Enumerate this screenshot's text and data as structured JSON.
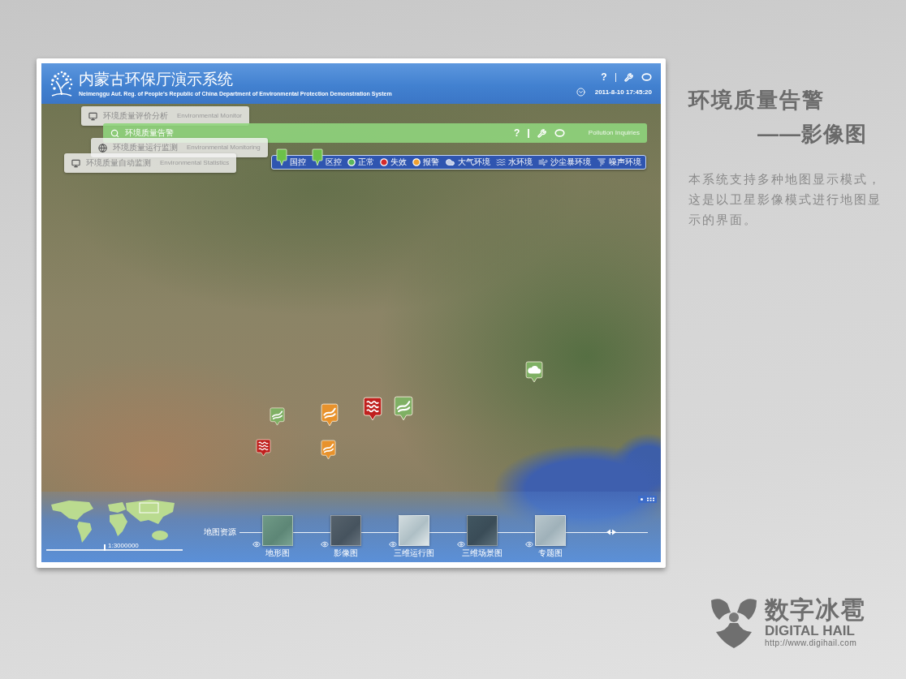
{
  "app_header": {
    "title": "内蒙古环保厅演示系统",
    "subtitle": "Neimenggu Aut. Reg. of People's Republic of China Department of Environmental Protection Demonstration System",
    "help": "?",
    "datetime": "2011-8-10 17:45:20"
  },
  "menus": [
    {
      "label": "环境质量评价分析",
      "english": "Environmental Monitor",
      "selected": false
    },
    {
      "label": "环境质量告警",
      "english": "Pollution Inquiries",
      "help": "?",
      "selected": true
    },
    {
      "label": "环境质量运行监测",
      "english": "Environmental Monitoring",
      "selected": false
    },
    {
      "label": "环境质量自动监测",
      "english": "Environmental Statistics",
      "selected": false
    }
  ],
  "legend": [
    {
      "kind": "pin",
      "label": "国控"
    },
    {
      "kind": "pin",
      "label": "区控"
    },
    {
      "kind": "status",
      "label": "正常",
      "color": "#5cb85c"
    },
    {
      "kind": "status",
      "label": "失效",
      "color": "#d42a2a"
    },
    {
      "kind": "status",
      "label": "报警",
      "color": "#f0a030"
    },
    {
      "kind": "air",
      "label": "大气环境"
    },
    {
      "kind": "water",
      "label": "水环境"
    },
    {
      "kind": "dust",
      "label": "沙尘暴环境"
    },
    {
      "kind": "noise",
      "label": "噪声环境"
    }
  ],
  "markers": [
    {
      "kind": "dust",
      "color": "#7fb064"
    },
    {
      "kind": "dust",
      "color": "#e8922c"
    },
    {
      "kind": "water",
      "color": "#c0201e"
    },
    {
      "kind": "dust",
      "color": "#7fb064"
    },
    {
      "kind": "water",
      "color": "#c0201e"
    },
    {
      "kind": "dust",
      "color": "#e8922c"
    },
    {
      "kind": "air",
      "color": "#7fb064"
    }
  ],
  "bottom_panel": {
    "scale": "1:3000000",
    "resources_label": "地图资源",
    "modes": [
      {
        "label": "地形图"
      },
      {
        "label": "影像图"
      },
      {
        "label": "三维运行图"
      },
      {
        "label": "三维场景图"
      },
      {
        "label": "专题图"
      }
    ]
  },
  "slide": {
    "title": "环境质量告警",
    "subtitle": "——影像图",
    "description": "本系统支持多种地图显示模式，这是以卫星影像模式进行地图显示的界面。"
  },
  "logo": {
    "name": "数字冰雹",
    "english": "DIGITAL HAIL",
    "url": "http://www.digihail.com"
  }
}
